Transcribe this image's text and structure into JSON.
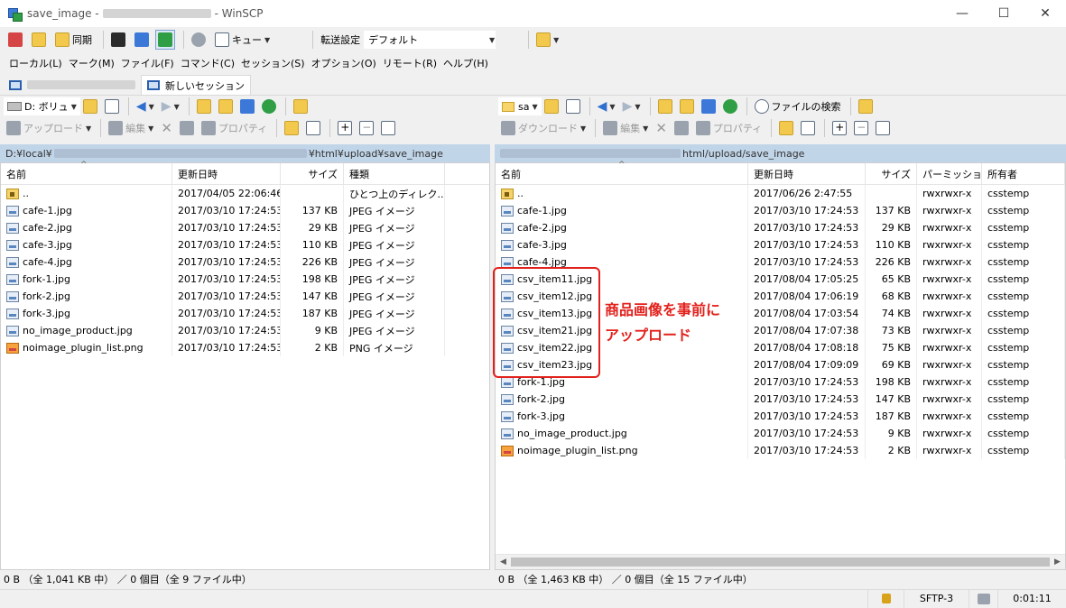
{
  "window": {
    "title_prefix": "save_image - ",
    "title_suffix": " - WinSCP",
    "minimize": "—",
    "maximize": "☐",
    "close": "✕"
  },
  "toolbar": {
    "sync_label": "同期",
    "queue_label": "キュー",
    "transfer_settings_label": "転送設定",
    "transfer_preset": "デフォルト"
  },
  "menu": [
    "ローカル(L)",
    "マーク(M)",
    "ファイル(F)",
    "コマンド(C)",
    "セッション(S)",
    "オプション(O)",
    "リモート(R)",
    "ヘルプ(H)"
  ],
  "tabs": {
    "new_session": "新しいセッション"
  },
  "left": {
    "drive": "D: ボリュ",
    "upload": "アップロード",
    "edit": "編集",
    "properties": "プロパティ",
    "path_prefix": "D:¥local¥",
    "path_suffix": "¥html¥upload¥save_image",
    "headers": [
      "名前",
      "更新日時",
      "サイズ",
      "種類"
    ],
    "files": [
      {
        "name": "..",
        "date": "2017/04/05  22:06:46",
        "size": "",
        "type": "ひとつ上のディレク...",
        "icon": "up"
      },
      {
        "name": "cafe-1.jpg",
        "date": "2017/03/10  17:24:53",
        "size": "137 KB",
        "type": "JPEG イメージ",
        "icon": "img"
      },
      {
        "name": "cafe-2.jpg",
        "date": "2017/03/10  17:24:53",
        "size": "29 KB",
        "type": "JPEG イメージ",
        "icon": "img"
      },
      {
        "name": "cafe-3.jpg",
        "date": "2017/03/10  17:24:53",
        "size": "110 KB",
        "type": "JPEG イメージ",
        "icon": "img"
      },
      {
        "name": "cafe-4.jpg",
        "date": "2017/03/10  17:24:53",
        "size": "226 KB",
        "type": "JPEG イメージ",
        "icon": "img"
      },
      {
        "name": "fork-1.jpg",
        "date": "2017/03/10  17:24:53",
        "size": "198 KB",
        "type": "JPEG イメージ",
        "icon": "img"
      },
      {
        "name": "fork-2.jpg",
        "date": "2017/03/10  17:24:53",
        "size": "147 KB",
        "type": "JPEG イメージ",
        "icon": "img"
      },
      {
        "name": "fork-3.jpg",
        "date": "2017/03/10  17:24:53",
        "size": "187 KB",
        "type": "JPEG イメージ",
        "icon": "img"
      },
      {
        "name": "no_image_product.jpg",
        "date": "2017/03/10  17:24:53",
        "size": "9 KB",
        "type": "JPEG イメージ",
        "icon": "img"
      },
      {
        "name": "noimage_plugin_list.png",
        "date": "2017/03/10  17:24:53",
        "size": "2 KB",
        "type": "PNG イメージ",
        "icon": "png"
      }
    ],
    "status": "0 B （全 1,041 KB 中） ／ 0 個目（全 9 ファイル中）"
  },
  "right": {
    "drive": "sa",
    "download": "ダウンロード",
    "edit": "編集",
    "properties": "プロパティ",
    "find_files": "ファイルの検索",
    "path_suffix": "html/upload/save_image",
    "headers": [
      "名前",
      "更新日時",
      "サイズ",
      "パーミッション",
      "所有者"
    ],
    "files": [
      {
        "name": "..",
        "date": "2017/06/26 2:47:55",
        "size": "",
        "perm": "rwxrwxr-x",
        "owner": "csstemp",
        "icon": "up"
      },
      {
        "name": "cafe-1.jpg",
        "date": "2017/03/10 17:24:53",
        "size": "137 KB",
        "perm": "rwxrwxr-x",
        "owner": "csstemp",
        "icon": "img"
      },
      {
        "name": "cafe-2.jpg",
        "date": "2017/03/10 17:24:53",
        "size": "29 KB",
        "perm": "rwxrwxr-x",
        "owner": "csstemp",
        "icon": "img"
      },
      {
        "name": "cafe-3.jpg",
        "date": "2017/03/10 17:24:53",
        "size": "110 KB",
        "perm": "rwxrwxr-x",
        "owner": "csstemp",
        "icon": "img"
      },
      {
        "name": "cafe-4.jpg",
        "date": "2017/03/10 17:24:53",
        "size": "226 KB",
        "perm": "rwxrwxr-x",
        "owner": "csstemp",
        "icon": "img"
      },
      {
        "name": "csv_item11.jpg",
        "date": "2017/08/04 17:05:25",
        "size": "65 KB",
        "perm": "rwxrwxr-x",
        "owner": "csstemp",
        "icon": "img"
      },
      {
        "name": "csv_item12.jpg",
        "date": "2017/08/04 17:06:19",
        "size": "68 KB",
        "perm": "rwxrwxr-x",
        "owner": "csstemp",
        "icon": "img"
      },
      {
        "name": "csv_item13.jpg",
        "date": "2017/08/04 17:03:54",
        "size": "74 KB",
        "perm": "rwxrwxr-x",
        "owner": "csstemp",
        "icon": "img"
      },
      {
        "name": "csv_item21.jpg",
        "date": "2017/08/04 17:07:38",
        "size": "73 KB",
        "perm": "rwxrwxr-x",
        "owner": "csstemp",
        "icon": "img"
      },
      {
        "name": "csv_item22.jpg",
        "date": "2017/08/04 17:08:18",
        "size": "75 KB",
        "perm": "rwxrwxr-x",
        "owner": "csstemp",
        "icon": "img"
      },
      {
        "name": "csv_item23.jpg",
        "date": "2017/08/04 17:09:09",
        "size": "69 KB",
        "perm": "rwxrwxr-x",
        "owner": "csstemp",
        "icon": "img"
      },
      {
        "name": "fork-1.jpg",
        "date": "2017/03/10 17:24:53",
        "size": "198 KB",
        "perm": "rwxrwxr-x",
        "owner": "csstemp",
        "icon": "img"
      },
      {
        "name": "fork-2.jpg",
        "date": "2017/03/10 17:24:53",
        "size": "147 KB",
        "perm": "rwxrwxr-x",
        "owner": "csstemp",
        "icon": "img"
      },
      {
        "name": "fork-3.jpg",
        "date": "2017/03/10 17:24:53",
        "size": "187 KB",
        "perm": "rwxrwxr-x",
        "owner": "csstemp",
        "icon": "img"
      },
      {
        "name": "no_image_product.jpg",
        "date": "2017/03/10 17:24:53",
        "size": "9 KB",
        "perm": "rwxrwxr-x",
        "owner": "csstemp",
        "icon": "img"
      },
      {
        "name": "noimage_plugin_list.png",
        "date": "2017/03/10 17:24:53",
        "size": "2 KB",
        "perm": "rwxrwxr-x",
        "owner": "csstemp",
        "icon": "png"
      }
    ],
    "status": "0 B （全 1,463 KB 中） ／ 0 個目（全 15 ファイル中）"
  },
  "bottom": {
    "protocol": "SFTP-3",
    "elapsed": "0:01:11"
  },
  "annotation": {
    "line1": "商品画像を事前に",
    "line2": "アップロード",
    "color": "#e2211c"
  }
}
